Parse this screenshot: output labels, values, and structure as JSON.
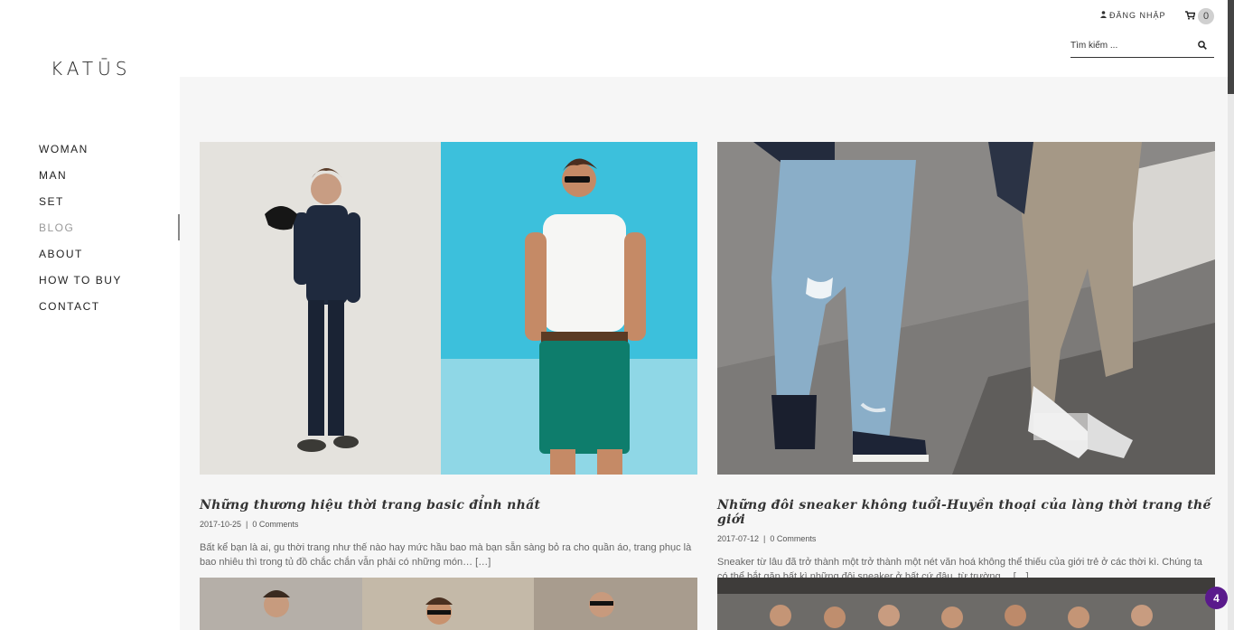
{
  "header": {
    "login_label": "ĐĂNG NHẬP",
    "cart_count": "0",
    "search_placeholder": "Tìm kiếm ..."
  },
  "brand": {
    "logo_text": "KATŪS"
  },
  "nav": {
    "items": [
      {
        "label": "WOMAN"
      },
      {
        "label": "MAN"
      },
      {
        "label": "SET"
      },
      {
        "label": "BLOG"
      },
      {
        "label": "ABOUT"
      },
      {
        "label": "HOW TO BUY"
      },
      {
        "label": "CONTACT"
      }
    ]
  },
  "posts": [
    {
      "title": "Những thương hiệu thời trang basic đỉnh nhất",
      "date": "2017-10-25",
      "separator": "|",
      "comments": "0 Comments",
      "excerpt": "Bất kể bạn là ai, gu thời trang như thế nào hay mức hầu bao mà bạn sẵn sàng bỏ ra cho quần áo, trang phục là bao nhiêu thì trong tủ đồ chắc chắn vẫn phải có những món… […]"
    },
    {
      "title": "Những đôi sneaker không tuổi-Huyền thoại của làng thời trang thế giới",
      "date": "2017-07-12",
      "separator": "|",
      "comments": "0 Comments",
      "excerpt": "Sneaker từ lâu đã trở thành một trở thành một nét văn hoá không thể thiếu của giới trẻ ở các thời kì. Chúng ta có thể bắt gặp bất kì những đôi sneaker ở bất cứ đâu, từ trường… […]"
    }
  ],
  "notification_count": "4",
  "colors": {
    "accent": "#5a1a8c",
    "content_bg": "#f6f6f6"
  }
}
